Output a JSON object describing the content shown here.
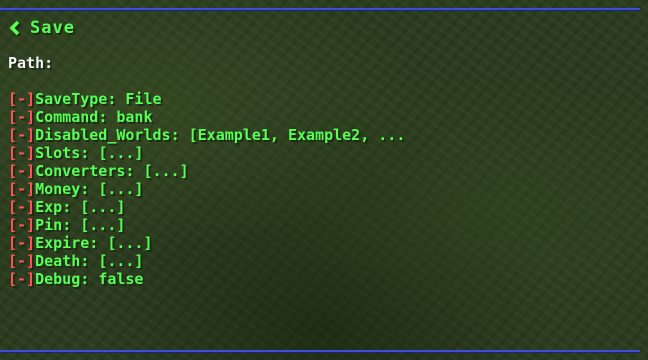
{
  "header": {
    "back_label": "Save"
  },
  "path": {
    "label": "Path:",
    "value": ""
  },
  "toggle_symbol": "[-]",
  "settings": [
    {
      "key": "SaveType",
      "separator": ": ",
      "value": "File"
    },
    {
      "key": "Command",
      "separator": ": ",
      "value": "bank"
    },
    {
      "key": "Disabled_Worlds",
      "separator": ": ",
      "value": "[Example1, Example2, ..."
    },
    {
      "key": "Slots",
      "separator": ": ",
      "value": "[...]"
    },
    {
      "key": "Converters",
      "separator": ": ",
      "value": "[...]"
    },
    {
      "key": "Money",
      "separator": ": ",
      "value": "[...]"
    },
    {
      "key": "Exp",
      "separator": ": ",
      "value": "[...]"
    },
    {
      "key": "Pin",
      "separator": ": ",
      "value": "[...]"
    },
    {
      "key": "Expire",
      "separator": ": ",
      "value": "[...]"
    },
    {
      "key": "Death",
      "separator": ": ",
      "value": "[...]"
    },
    {
      "key": "Debug",
      "separator": ": ",
      "value": "false"
    }
  ],
  "colors": {
    "header_green": "#55ff55",
    "toggle_red": "#ff5555",
    "rule_blue": "#3d4fd6",
    "path_white": "#f4f4f4"
  }
}
